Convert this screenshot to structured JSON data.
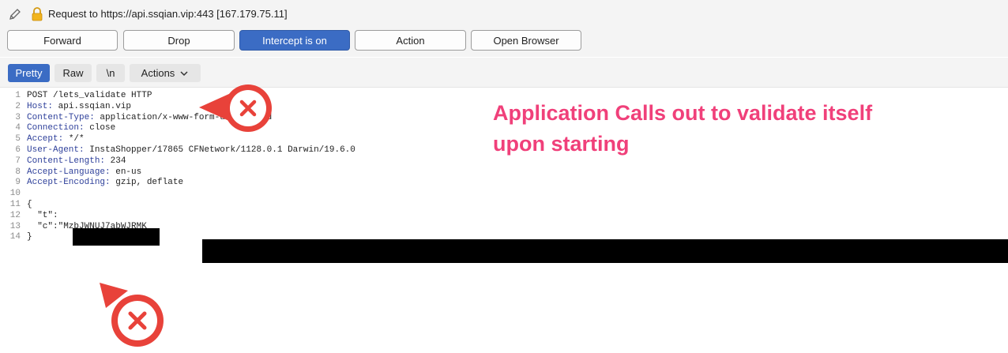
{
  "title_bar": {
    "text": "Request to https://api.ssqian.vip:443  [167.179.75.11]",
    "edit_icon": "pencil-icon",
    "lock_icon": "lock-icon"
  },
  "toolbar": {
    "buttons": [
      {
        "label": "Forward",
        "active": false
      },
      {
        "label": "Drop",
        "active": false
      },
      {
        "label": "Intercept is on",
        "active": true
      },
      {
        "label": "Action",
        "active": false
      },
      {
        "label": "Open Browser",
        "active": false
      }
    ]
  },
  "view_tabs": {
    "pretty": "Pretty",
    "raw": "Raw",
    "newline": "\\n",
    "actions": "Actions",
    "actions_icon": "chevron-down-icon"
  },
  "request": {
    "lines": [
      {
        "num": "1",
        "key": "",
        "value": "POST /lets_validate HTTP"
      },
      {
        "num": "2",
        "key": "Host:",
        "value": " api.ssqian.vip"
      },
      {
        "num": "3",
        "key": "Content-Type:",
        "value": " application/x-www-form-urlencoded"
      },
      {
        "num": "4",
        "key": "Connection:",
        "value": " close"
      },
      {
        "num": "5",
        "key": "Accept:",
        "value": " */*"
      },
      {
        "num": "6",
        "key": "User-Agent:",
        "value": " InstaShopper/17865 CFNetwork/1128.0.1 Darwin/19.6.0"
      },
      {
        "num": "7",
        "key": "Content-Length:",
        "value": " 234"
      },
      {
        "num": "8",
        "key": "Accept-Language:",
        "value": " en-us"
      },
      {
        "num": "9",
        "key": "Accept-Encoding:",
        "value": " gzip, deflate"
      },
      {
        "num": "10",
        "key": "",
        "value": ""
      },
      {
        "num": "11",
        "key": "",
        "value": "{"
      },
      {
        "num": "12",
        "key": "",
        "value": "  \"t\":"
      },
      {
        "num": "13",
        "key": "",
        "value": "  \"c\":\"MzbJWNUJ7abWJRMK"
      },
      {
        "num": "14",
        "key": "",
        "value": "}"
      }
    ]
  },
  "annotation": {
    "line1": "Application Calls out to validate itself",
    "line2": "upon starting",
    "color": "#f0407a",
    "marker_icon": "x-circle-icon"
  },
  "colors": {
    "accent": "#3b6cc4",
    "annotation": "#f0407a",
    "marker": "#e8423a"
  }
}
